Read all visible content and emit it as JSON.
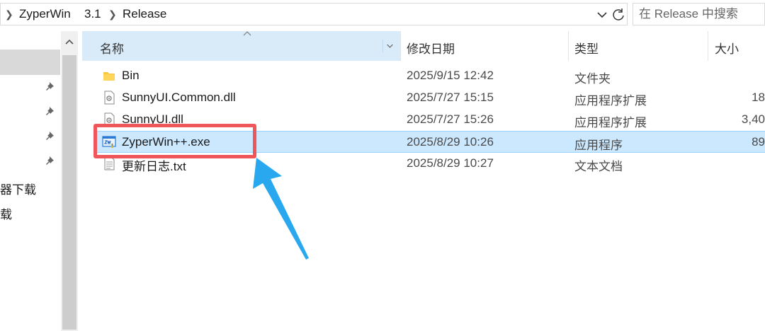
{
  "address_bar": {
    "crumbs": [
      "ZyperWin",
      "3.1",
      "Release"
    ]
  },
  "search": {
    "placeholder": "在 Release 中搜索"
  },
  "nav_pane": {
    "items": [
      "器下载",
      "载"
    ]
  },
  "columns": {
    "name": "名称",
    "date": "修改日期",
    "type": "类型",
    "size": "大小"
  },
  "files": [
    {
      "name": "Bin",
      "date": "2025/9/15 12:42",
      "type": "文件夹",
      "size": "",
      "icon": "folder-icon"
    },
    {
      "name": "SunnyUI.Common.dll",
      "date": "2025/7/27 15:15",
      "type": "应用程序扩展",
      "size": "18",
      "icon": "dll-file-icon"
    },
    {
      "name": "SunnyUI.dll",
      "date": "2025/7/27 15:26",
      "type": "应用程序扩展",
      "size": "3,40",
      "icon": "dll-file-icon"
    },
    {
      "name": "ZyperWin++.exe",
      "date": "2025/8/29 10:26",
      "type": "应用程序",
      "size": "89",
      "icon": "exe-app-icon"
    },
    {
      "name": "更新日志.txt",
      "date": "2025/8/29 10:27",
      "type": "文本文档",
      "size": "",
      "icon": "text-file-icon"
    }
  ],
  "colors": {
    "selected_row": "#cce8ff",
    "header_active": "#d9ebf9",
    "highlight": "#ef5659",
    "arrow": "#29a8ef",
    "folder": "#f8c93e"
  }
}
